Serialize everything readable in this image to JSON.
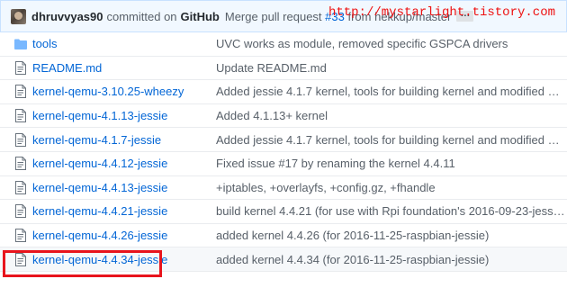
{
  "commit": {
    "author": "dhruvvyas90",
    "committed_text": "committed on",
    "platform": "GitHub",
    "message": "Merge pull request ",
    "pr_number": "#33",
    "message_tail": " from hekkup/master",
    "more_label": "…"
  },
  "watermark": "http://mystarlight.tistory.com",
  "files": [
    {
      "name": "tools",
      "icon": "folder-icon",
      "message": "UVC works as module, removed specific GSPCA drivers"
    },
    {
      "name": "README.md",
      "icon": "file-icon",
      "message": "Update README.md"
    },
    {
      "name": "kernel-qemu-3.10.25-wheezy",
      "icon": "file-icon",
      "message": "Added jessie 4.1.7 kernel, tools for building kernel and modified REA…"
    },
    {
      "name": "kernel-qemu-4.1.13-jessie",
      "icon": "file-icon",
      "message": "Added 4.1.13+ kernel"
    },
    {
      "name": "kernel-qemu-4.1.7-jessie",
      "icon": "file-icon",
      "message": "Added jessie 4.1.7 kernel, tools for building kernel and modified REA…"
    },
    {
      "name": "kernel-qemu-4.4.12-jessie",
      "icon": "file-icon",
      "message": "Fixed issue #17 by renaming the kernel 4.4.11"
    },
    {
      "name": "kernel-qemu-4.4.13-jessie",
      "icon": "file-icon",
      "message": "+iptables, +overlayfs, +config.gz, +fhandle"
    },
    {
      "name": "kernel-qemu-4.4.21-jessie",
      "icon": "file-icon",
      "message": "build kernel 4.4.21 (for use with Rpi foundation's 2016-09-23-jessie …"
    },
    {
      "name": "kernel-qemu-4.4.26-jessie",
      "icon": "file-icon",
      "message": "added kernel 4.4.26 (for 2016-11-25-raspbian-jessie)"
    },
    {
      "name": "kernel-qemu-4.4.34-jessie",
      "icon": "file-icon",
      "message": "added kernel 4.4.34 (for 2016-11-25-raspbian-jessie)"
    }
  ],
  "colors": {
    "link": "#0366d6",
    "folder_icon": "#79b8ff",
    "highlight": "#e8141c",
    "watermark": "#ee1111"
  }
}
